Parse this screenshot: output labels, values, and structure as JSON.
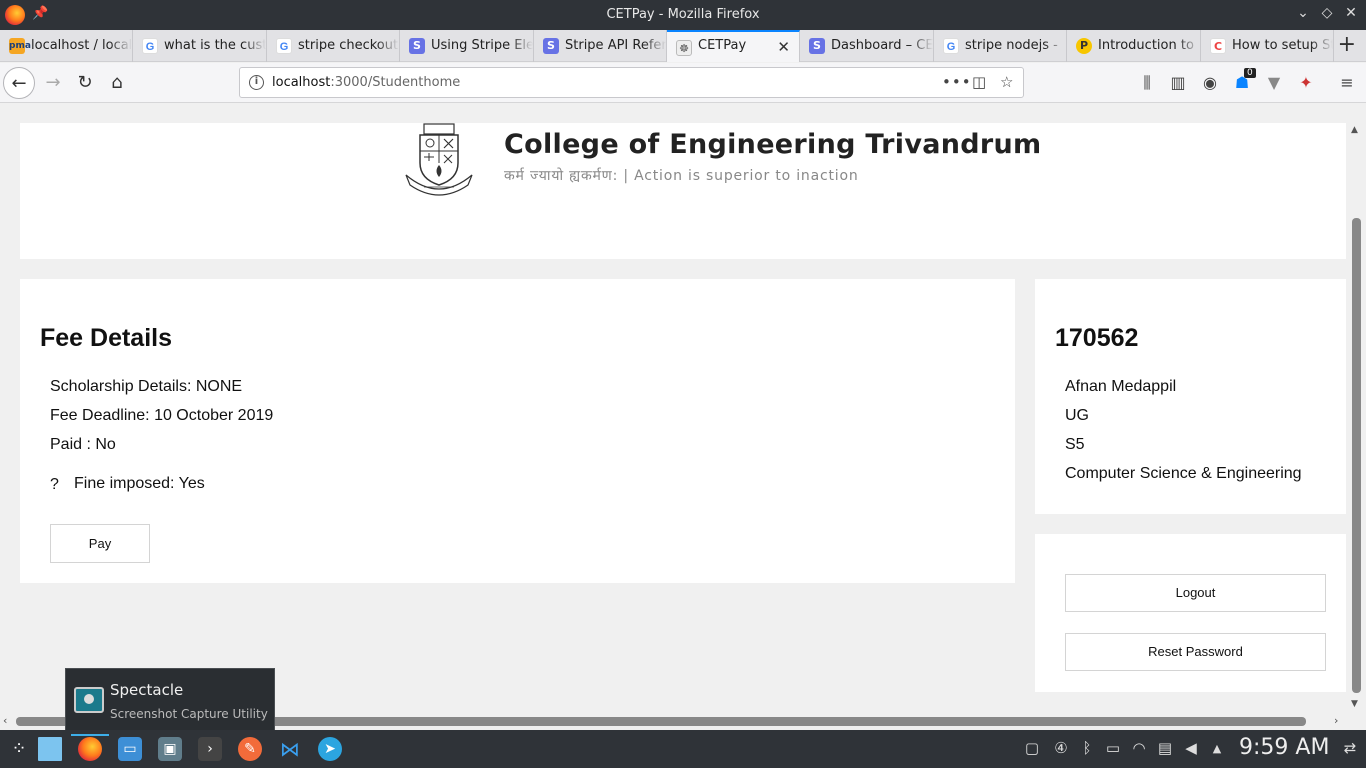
{
  "window": {
    "title": "CETPay - Mozilla Firefox",
    "controls": [
      "⌄",
      "◇",
      "✕"
    ]
  },
  "tabs": [
    {
      "label": "localhost / localhost",
      "favicon": "phpmyadmin-icon",
      "fav_text": "pma"
    },
    {
      "label": "what is the customer",
      "favicon": "google-icon",
      "fav_text": "G"
    },
    {
      "label": "stripe checkout",
      "favicon": "google-icon",
      "fav_text": "G"
    },
    {
      "label": "Using Stripe Elements",
      "favicon": "stripe-icon",
      "fav_text": "S"
    },
    {
      "label": "Stripe API Reference",
      "favicon": "stripe-icon",
      "fav_text": "S"
    },
    {
      "label": "CETPay",
      "favicon": "cet-icon",
      "fav_text": "☸",
      "active": true
    },
    {
      "label": "Dashboard – CETPay",
      "favicon": "stripe-icon",
      "fav_text": "S"
    },
    {
      "label": "stripe nodejs -",
      "favicon": "google-icon",
      "fav_text": "G"
    },
    {
      "label": "Introduction to",
      "favicon": "python-icon",
      "fav_text": "P"
    },
    {
      "label": "How to setup Stripe",
      "favicon": "codeburst-icon",
      "fav_text": "C"
    }
  ],
  "navbar": {
    "url_host": "localhost",
    "url_path": ":3000/Studenthome",
    "notification_count": "0"
  },
  "page": {
    "college_name": "College of Engineering Trivandrum",
    "motto": "कर्म ज्यायो ह्यकर्मण: | Action is superior to inaction",
    "fee": {
      "title": "Fee Details",
      "scholarship": "Scholarship Details: NONE",
      "deadline": "Fee Deadline: 10 October 2019",
      "paid": "Paid : No",
      "fine_icon": "?",
      "fine": "Fine imposed: Yes",
      "pay_label": "Pay"
    },
    "student": {
      "id": "170562",
      "name": "Afnan Medappil",
      "program": "UG",
      "semester": "S5",
      "department": "Computer Science & Engineering"
    },
    "actions": {
      "logout_label": "Logout",
      "reset_label": "Reset Password"
    }
  },
  "tooltip": {
    "name": "Spectacle",
    "description": "Screenshot Capture Utility"
  },
  "taskbar": {
    "time": "9:59 AM",
    "virtual_desktop": "④"
  },
  "colors": {
    "tab_accent": "#0a84ff",
    "stripe": "#6772e5",
    "taskbar_bg": "#2f3338",
    "page_bg": "#f0f0f0"
  }
}
